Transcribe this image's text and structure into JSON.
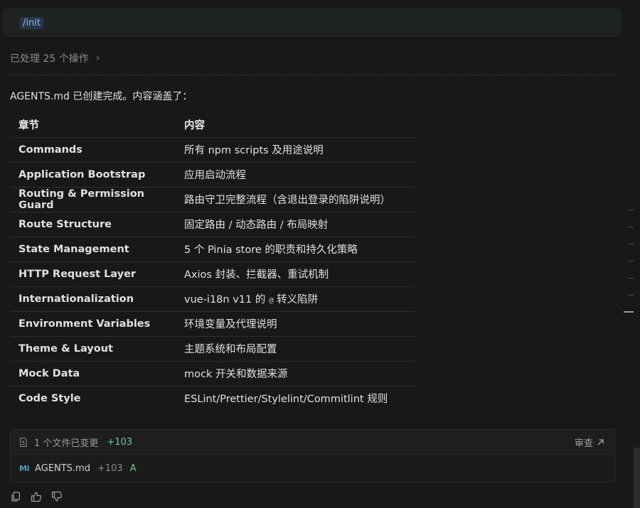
{
  "command": "/init",
  "processed": {
    "label": "已处理 25 个操作"
  },
  "intro": "AGENTS.md 已创建完成。内容涵盖了：",
  "table": {
    "headers": [
      "章节",
      "内容"
    ],
    "rows": [
      {
        "section": "Commands",
        "content": "所有 npm scripts 及用途说明"
      },
      {
        "section": "Application Bootstrap",
        "content": "应用启动流程"
      },
      {
        "section": "Routing & Permission Guard",
        "content": "路由守卫完整流程（含退出登录的陷阱说明）"
      },
      {
        "section": "Route Structure",
        "content": "固定路由 / 动态路由 / 布局映射"
      },
      {
        "section": "State Management",
        "content": "5 个 Pinia store 的职责和持久化策略"
      },
      {
        "section": "HTTP Request Layer",
        "content": "Axios 封装、拦截器、重试机制"
      },
      {
        "section": "Internationalization",
        "content_before": "vue-i18n v11 的 ",
        "content_code": "@",
        "content_after": " 转义陷阱"
      },
      {
        "section": "Environment Variables",
        "content": "环境变量及代理说明"
      },
      {
        "section": "Theme & Layout",
        "content": "主题系统和布局配置"
      },
      {
        "section": "Mock Data",
        "content": "mock 开关和数据来源"
      },
      {
        "section": "Code Style",
        "content": "ESLint/Prettier/Stylelint/Commitlint 规则"
      }
    ]
  },
  "changes": {
    "summary": "1 个文件已变更",
    "additions": "+103",
    "review_label": "审查",
    "file": {
      "icon": "MI",
      "name": "AGENTS.md",
      "additions": "+103",
      "status": "A"
    }
  },
  "colors": {
    "accent_green": "#73c991",
    "md_icon_blue": "#519aba",
    "cmd_highlight": "#24364a"
  }
}
